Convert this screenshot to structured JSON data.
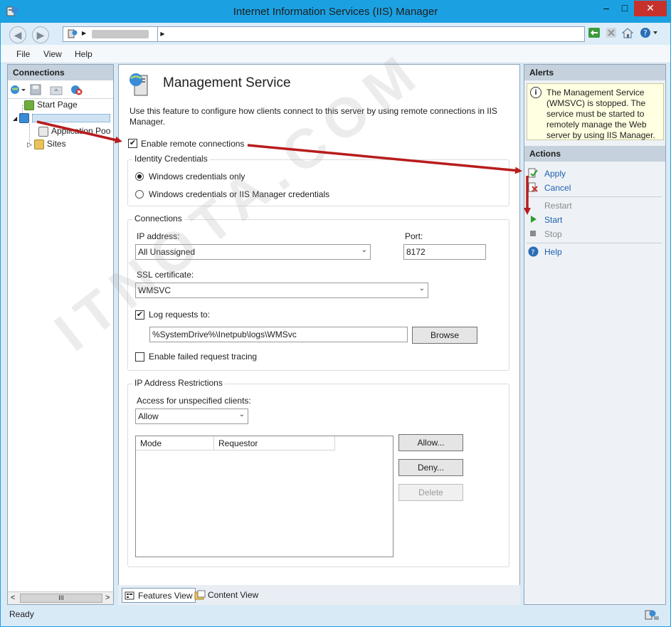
{
  "window": {
    "title": "Internet Information Services (IIS) Manager",
    "min_glyph": "–",
    "max_glyph": "□",
    "close_glyph": "✕"
  },
  "nav": {
    "back": "◀",
    "forward": "▶",
    "addr_sep": "▶"
  },
  "menu": {
    "file": "File",
    "view": "View",
    "help": "Help"
  },
  "connections": {
    "header": "Connections",
    "tree": {
      "start_page": "Start Page",
      "app_pools": "Application Poo",
      "sites": "Sites",
      "expand": "◢",
      "collapsed": "▷"
    },
    "scroll": {
      "left": "<",
      "thumb": "III",
      "right": ">"
    }
  },
  "main": {
    "title": "Management Service",
    "description": "Use this feature to configure how clients connect to this server by using remote connections in IIS Manager.",
    "enable_remote": {
      "label": "Enable remote connections",
      "checked": true
    },
    "identity": {
      "title": "Identity Credentials",
      "option1": "Windows credentials only",
      "option2": "Windows credentials or IIS Manager credentials",
      "selected": "option1"
    },
    "connections_group": {
      "title": "Connections",
      "ip_label": "IP address:",
      "ip_value": "All Unassigned",
      "port_label": "Port:",
      "port_value": "8172",
      "ssl_label": "SSL certificate:",
      "ssl_value": "WMSVC",
      "log_label": "Log requests to:",
      "log_checked": true,
      "log_path": "%SystemDrive%\\Inetpub\\logs\\WMSvc",
      "browse": "Browse",
      "failed_tracing": "Enable failed request tracing",
      "failed_checked": false
    },
    "ip_restrictions": {
      "title": "IP Address Restrictions",
      "access_label": "Access for unspecified clients:",
      "access_value": "Allow",
      "columns": [
        "Mode",
        "Requestor"
      ],
      "allow_btn": "Allow...",
      "deny_btn": "Deny...",
      "delete_btn": "Delete"
    },
    "check_mark": "✔",
    "combo_arrow": "⌄"
  },
  "view_tabs": {
    "features": "Features View",
    "content": "Content View"
  },
  "alerts": {
    "header": "Alerts",
    "icon": "i",
    "message": "The Management Service (WMSVC) is stopped. The service must be started to remotely manage the Web server by using IIS Manager."
  },
  "actions": {
    "header": "Actions",
    "apply": "Apply",
    "cancel": "Cancel",
    "restart": "Restart",
    "start": "Start",
    "stop": "Stop",
    "help": "Help",
    "disabled": [
      "Restart",
      "Stop"
    ]
  },
  "status": {
    "text": "Ready"
  },
  "watermark": "ITNOTA.COM",
  "colors": {
    "titlebar": "#1ba1e2",
    "close": "#c7312b",
    "link": "#1e60b0",
    "arrow": "#b81c1c",
    "alert_bg": "#ffffe1"
  }
}
